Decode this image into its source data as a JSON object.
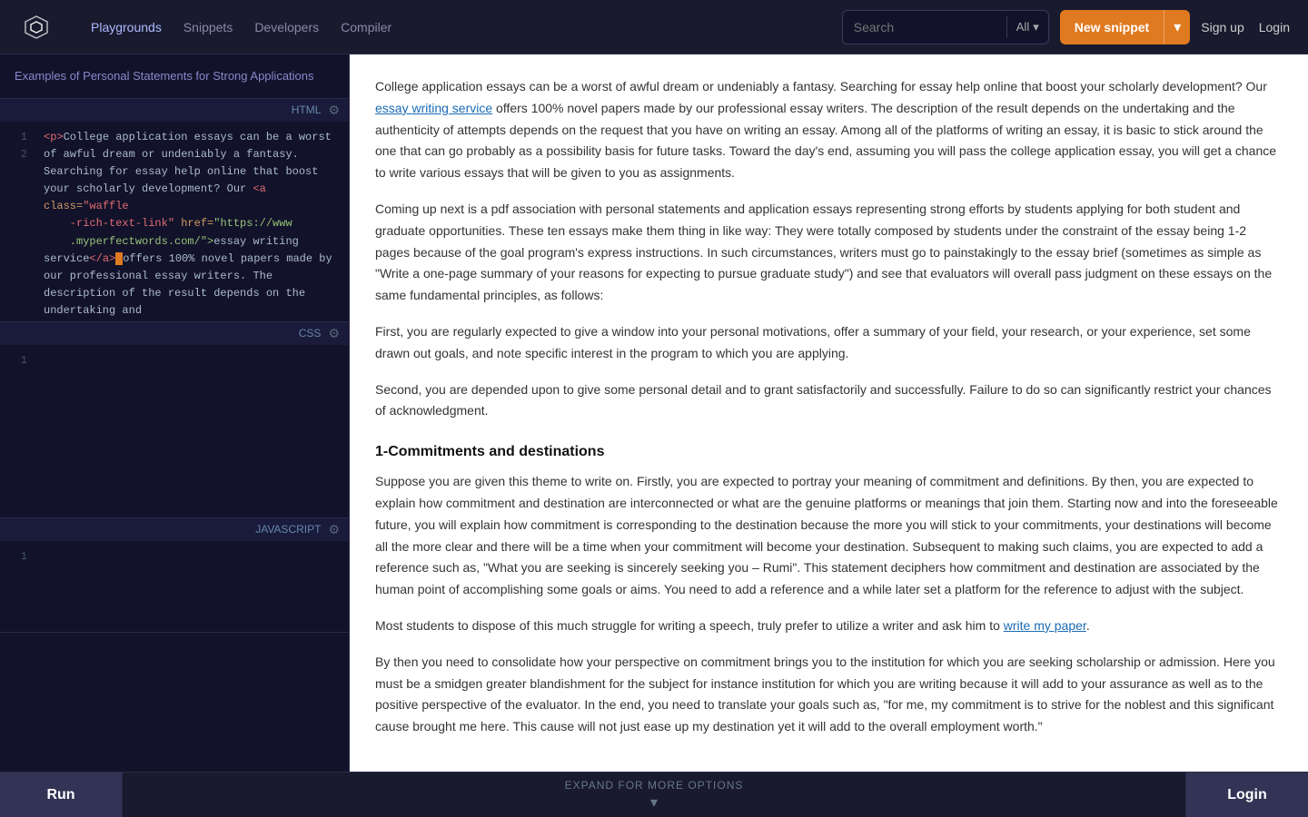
{
  "header": {
    "logo_alt": "OpenAI Code Logo",
    "nav": [
      {
        "label": "Playgrounds",
        "active": true
      },
      {
        "label": "Snippets",
        "active": false
      },
      {
        "label": "Developers",
        "active": false
      },
      {
        "label": "Compiler",
        "active": false
      }
    ],
    "search_placeholder": "Search",
    "search_filter": "All",
    "new_snippet_label": "New snippet",
    "sign_up_label": "Sign up",
    "login_label": "Login"
  },
  "left_panel": {
    "title": "Examples of Personal Statements for Strong Applications",
    "sections": [
      {
        "lang": "HTML",
        "lines": [
          "1",
          "2"
        ],
        "code_html": true
      },
      {
        "lang": "CSS",
        "lines": [
          "1"
        ],
        "code_html": false
      },
      {
        "lang": "JAVASCRIPT",
        "lines": [
          "1"
        ],
        "code_html": false
      }
    ]
  },
  "right_panel": {
    "paragraphs": [
      "College application essays can be a worst of awful dream or undeniably a fantasy. Searching for essay help online that boost your scholarly development? Our essay writing service offers 100% novel papers made by our professional essay writers. The description of the result depends on the undertaking and the authenticity of attempts depends on the request that you have on writing an essay. Among all of the platforms of writing an essay, it is basic to stick around the one that can go probably as a possibility basis for future tasks. Toward the day's end, assuming you will pass the college application essay, you will get a chance to write various essays that will be given to you as assignments.",
      "Coming up next is a pdf association with personal statements and application essays representing strong efforts by students applying for both student and graduate opportunities. These ten essays make them thing in like way: They were totally composed by students under the constraint of the essay being 1-2 pages because of the goal program's express instructions. In such circumstances, writers must go to painstakingly to the essay brief (sometimes as simple as \"Write a one-page summary of your reasons for expecting to pursue graduate study\") and see that evaluators will overall pass judgment on these essays on the same fundamental principles, as follows:",
      "First, you are regularly expected to give a window into your personal motivations, offer a summary of your field, your research, or your experience, set some drawn out goals, and note specific interest in the program to which you are applying.",
      "Second, you are depended upon to give some personal detail and to grant satisfactorily and successfully. Failure to do so can significantly restrict your chances of acknowledgment.",
      "1-Commitments and destinations",
      "Suppose you are given this theme to write on. Firstly, you are expected to portray your meaning of commitment and definitions. By then, you are expected to explain how commitment and destination are interconnected or what are the genuine platforms or meanings that join them. Starting now and into the foreseeable future, you will explain how commitment is corresponding to the destination because the more you will stick to your commitments, your destinations will become all the more clear and there will be a time when your commitment will become your destination. Subsequent to making such claims, you are expected to add a reference such as, \"What you are seeking is sincerely seeking you – Rumi\". This statement deciphers how commitment and destination are associated by the human point of accomplishing some goals or aims. You need to add a reference and a while later set a platform for the reference to adjust with the subject.",
      "Most students to dispose of this much struggle for writing a speech, truly prefer to utilize a writer and ask him to write my paper.",
      "By then you need to consolidate how your perspective on commitment brings you to the institution for which you are seeking scholarship or admission. Here you must be a smidgen greater blandishment for the subject for instance institution for which you are writing because it will add to your assurance as well as to the positive perspective of the evaluator. In the end, you need to translate your goals such as, \"for me, my commitment is to strive for the noblest and this significant cause brought me here. This cause will not just ease up my destination yet it will add to the overall employment worth.\""
    ],
    "link_essay_writing": "essay writing service",
    "link_write_paper": "write my paper",
    "heading_commitments": "1-Commitments and destinations"
  },
  "bottom_bar": {
    "run_label": "Run",
    "expand_label": "EXPAND FOR MORE OPTIONS",
    "login_label": "Login"
  }
}
